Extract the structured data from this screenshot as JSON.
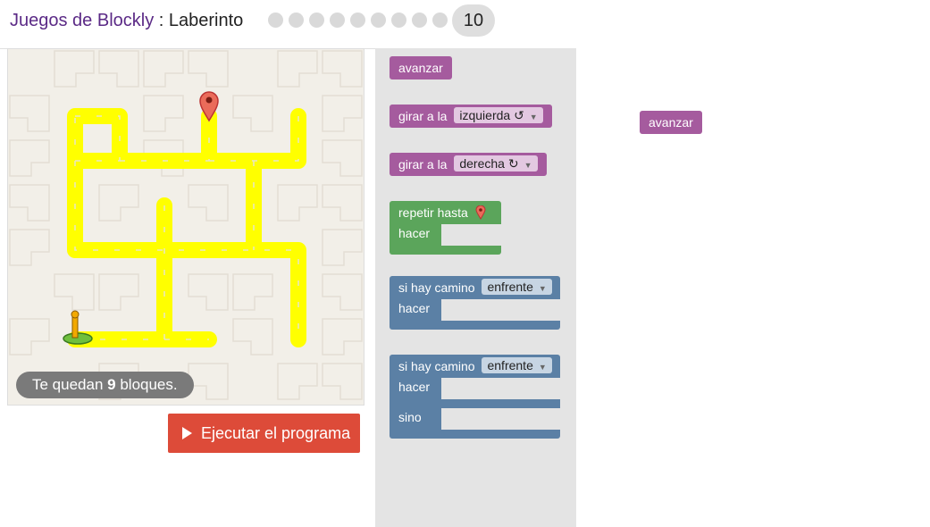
{
  "header": {
    "app_title": "Juegos de Blockly",
    "separator": " : ",
    "game_name": "Laberinto",
    "level_count": 10,
    "current_level": "10"
  },
  "maze": {
    "remaining_prefix": "Te quedan ",
    "remaining_count": "9",
    "remaining_suffix": " bloques."
  },
  "run_button": {
    "label": "Ejecutar el programa"
  },
  "toolbox": {
    "move_forward": "avanzar",
    "turn_left": {
      "label": "girar a la",
      "dir": "izquierda ↺"
    },
    "turn_right": {
      "label": "girar a la",
      "dir": "derecha ↻"
    },
    "repeat": {
      "label": "repetir hasta",
      "do": "hacer"
    },
    "if_path": {
      "label": "si hay camino",
      "dir": "enfrente",
      "do": "hacer"
    },
    "if_else": {
      "label": "si hay camino",
      "dir": "enfrente",
      "do": "hacer",
      "else": "sino"
    }
  },
  "workspace": {
    "block_label": "avanzar"
  },
  "colors": {
    "motion": "#a55b9e",
    "loop": "#5ba55b",
    "logic": "#5b80a5",
    "run": "#dd4b39",
    "path": "#ffff00",
    "title": "#5b2a86"
  }
}
